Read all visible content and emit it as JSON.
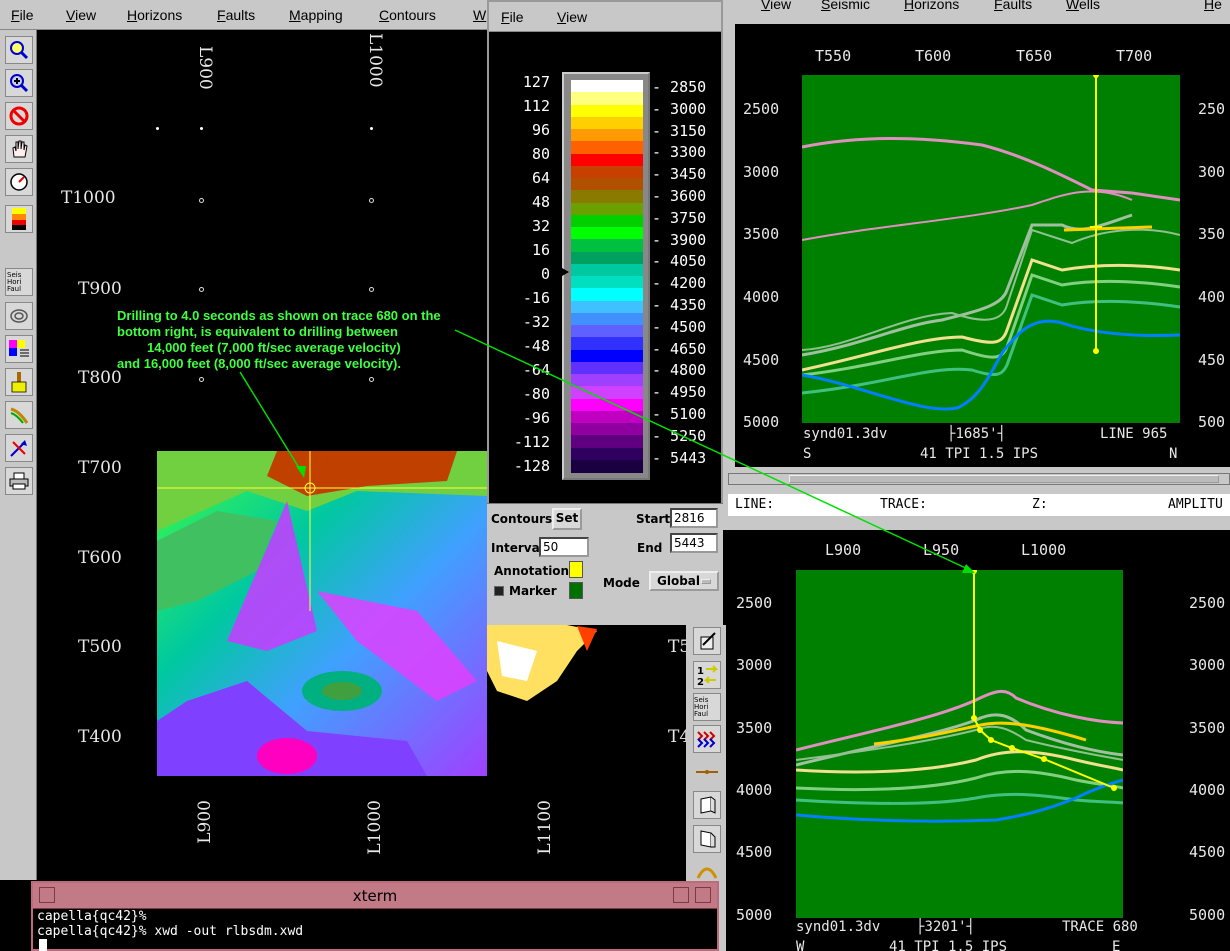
{
  "map_window": {
    "menu": [
      "File",
      "View",
      "Horizons",
      "Faults",
      "Mapping",
      "Contours",
      "W"
    ],
    "tools": [
      "zoom-fit-icon",
      "zoom-in-icon",
      "no-entry-icon",
      "hand-pan-icon",
      "gauge-icon",
      "colorbar-icon",
      "layers-toggle-icon",
      "contour-icon",
      "grid-legend-icon",
      "brush-icon",
      "curve-icon",
      "arrows-icon",
      "print-icon"
    ],
    "layer_toggle": [
      "Seis",
      "Hori",
      "Faul"
    ],
    "top_lines": [
      "L900",
      "L1000"
    ],
    "bottom_lines": [
      "L900",
      "L1000",
      "L1100"
    ],
    "traces": [
      "T1000",
      "T900",
      "T800",
      "T700",
      "T600",
      "T500",
      "T400"
    ],
    "right_traces": [
      "T5",
      "T4"
    ],
    "annotation": [
      "Drilling to 4.0 seconds as shown on trace 680 on the",
      "bottom right, is equivalent to drilling between",
      "14,000 feet (7,000 ft/sec average velocity)",
      "and 16,000 feet (8,000 ft/sec average velocity)."
    ]
  },
  "colorbar_dialog": {
    "menu": [
      "File",
      "View"
    ],
    "left_scale": [
      "127",
      "112",
      "96",
      "80",
      "64",
      "48",
      "32",
      "16",
      "0",
      "-16",
      "-32",
      "-48",
      "-64",
      "-80",
      "-96",
      "-112",
      "-128"
    ],
    "right_scale": [
      "2850",
      "3000",
      "3150",
      "3300",
      "3450",
      "3600",
      "3750",
      "3900",
      "4050",
      "4200",
      "4350",
      "4500",
      "4650",
      "4800",
      "4950",
      "5100",
      "5250",
      "5443"
    ],
    "colors": [
      "#ffffff",
      "#ffff80",
      "#ffff00",
      "#ffd000",
      "#ff9a00",
      "#ff6000",
      "#ff0000",
      "#c84000",
      "#b05000",
      "#8a7a00",
      "#6aa000",
      "#00d000",
      "#00ff00",
      "#00c040",
      "#00a060",
      "#00c8a0",
      "#00e0c0",
      "#00ffff",
      "#40c0ff",
      "#4090ff",
      "#6060ff",
      "#3030ff",
      "#0000ff",
      "#6030ff",
      "#a040ff",
      "#d040ff",
      "#ff00ff",
      "#c000c0",
      "#9000a0",
      "#600080",
      "#300060",
      "#1a0040"
    ],
    "contours_label": "Contours:",
    "set_button": "Set",
    "start_label": "Start",
    "start_value": "2816",
    "interval_label": "Interval",
    "interval_value": "50",
    "end_label": "End",
    "end_value": "5443",
    "annotation_label": "Annotation",
    "marker_label": "Marker",
    "mode_label": "Mode",
    "mode_value": "Global"
  },
  "top_section": {
    "menu": [
      "View",
      "Seismic",
      "Horizons",
      "Faults",
      "Wells",
      "He"
    ],
    "x_ticks": [
      "T550",
      "T600",
      "T650",
      "T700"
    ],
    "y_ticks": [
      "2500",
      "3000",
      "3500",
      "4000",
      "4500",
      "5000"
    ],
    "right_ticks": [
      "250",
      "300",
      "350",
      "400",
      "450",
      "500"
    ],
    "file": "synd01.3dv",
    "scale": "1685'",
    "line": "LINE 965",
    "dir_left": "S",
    "dir_right": "N",
    "tpi": "41 TPI 1.5 IPS"
  },
  "status_bar": {
    "line": "LINE:",
    "trace": "TRACE:",
    "z": "Z:",
    "amp": "AMPLITU"
  },
  "bottom_section": {
    "x_ticks": [
      "L900",
      "L950",
      "L1000"
    ],
    "y_ticks": [
      "2500",
      "3000",
      "3500",
      "4000",
      "4500",
      "5000"
    ],
    "file": "synd01.3dv",
    "scale": "3201'",
    "trace": "TRACE 680",
    "dir_left": "W",
    "dir_right": "E",
    "tpi": "41 TPI 1.5 IPS"
  },
  "mid_tools": [
    "arrow-box-icon",
    "swap-1-2-icon",
    "layers-toggle-icon",
    "chevrons-icon",
    "line-marker-icon",
    "cube-left-icon",
    "cube-right-icon",
    "arc-icon"
  ],
  "xterm": {
    "title": "xterm",
    "lines": [
      "capella{qc42}%",
      "capella{qc42}% xwd -out rlbsdm.xwd"
    ]
  }
}
